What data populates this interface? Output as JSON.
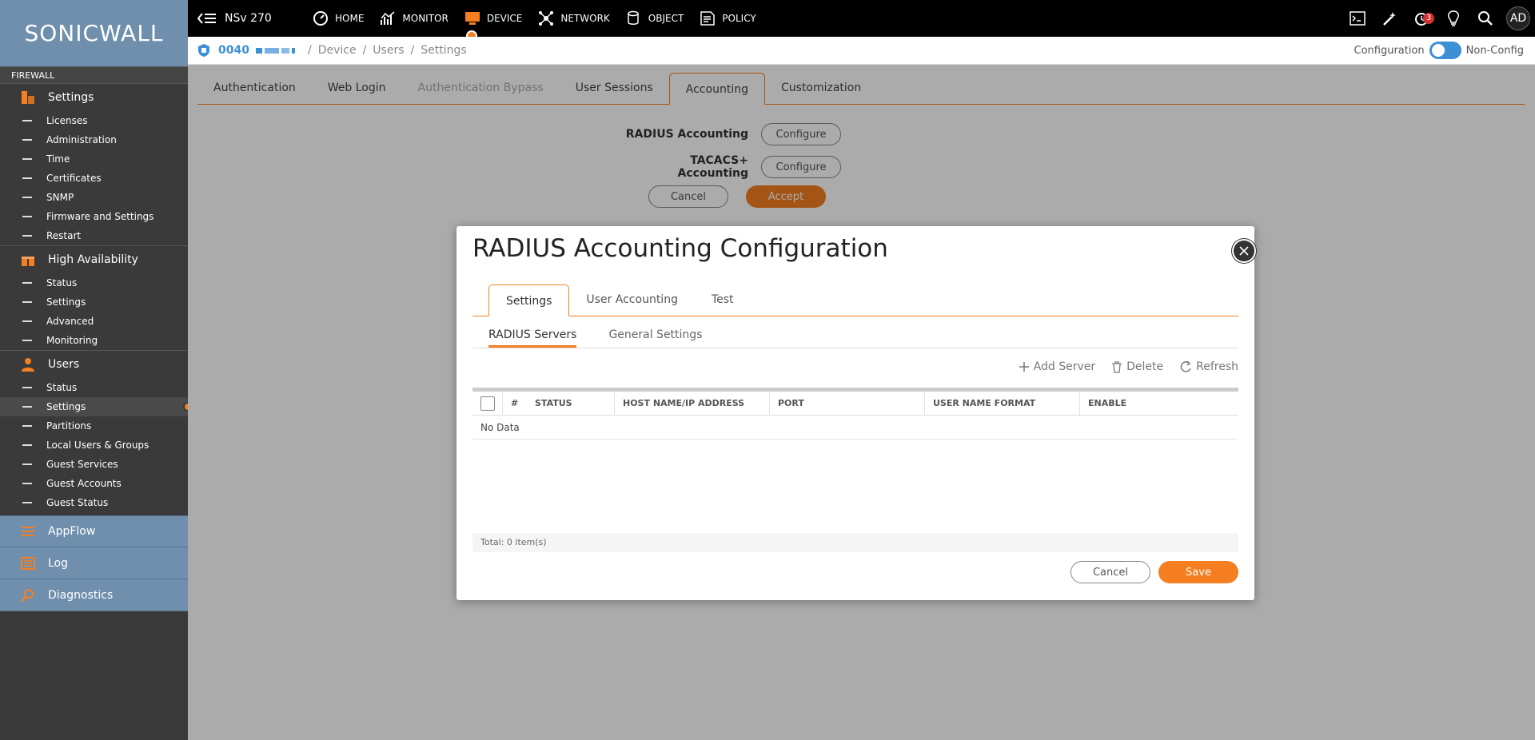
{
  "app": {
    "logo_text": "SONICWALL",
    "device_name": "NSv 270"
  },
  "sidebar": {
    "section_label": "FIREWALL",
    "groups": [
      {
        "label": "Settings",
        "items": [
          "Licenses",
          "Administration",
          "Time",
          "Certificates",
          "SNMP",
          "Firmware and Settings",
          "Restart"
        ]
      },
      {
        "label": "High Availability",
        "items": [
          "Status",
          "Settings",
          "Advanced",
          "Monitoring"
        ]
      },
      {
        "label": "Users",
        "items": [
          "Status",
          "Settings",
          "Partitions",
          "Local Users & Groups",
          "Guest Services",
          "Guest Accounts",
          "Guest Status"
        ]
      }
    ],
    "active_item": "Users / Settings",
    "bottom_items": [
      "AppFlow",
      "Log",
      "Diagnostics"
    ]
  },
  "topnav": {
    "items": [
      "HOME",
      "MONITOR",
      "DEVICE",
      "NETWORK",
      "OBJECT",
      "POLICY"
    ],
    "active": "DEVICE",
    "notification_count": "3",
    "avatar_initials": "AD"
  },
  "breadcrumb": {
    "serial": "0040",
    "items": [
      "Device",
      "Users",
      "Settings"
    ],
    "mode_left": "Configuration",
    "mode_right": "Non-Config"
  },
  "page": {
    "tabs": [
      "Authentication",
      "Web Login",
      "Authentication Bypass",
      "User Sessions",
      "Accounting",
      "Customization"
    ],
    "active_tab": "Accounting",
    "disabled_tab": "Authentication Bypass",
    "radius_label": "RADIUS Accounting",
    "tacacs_label": "TACACS+ Accounting",
    "configure_label": "Configure",
    "cancel_label": "Cancel",
    "accept_label": "Accept"
  },
  "modal": {
    "title": "RADIUS Accounting Configuration",
    "tabs": [
      "Settings",
      "User Accounting",
      "Test"
    ],
    "active_tab": "Settings",
    "sub_tabs": [
      "RADIUS Servers",
      "General Settings"
    ],
    "active_sub_tab": "RADIUS Servers",
    "toolbar": {
      "add": "Add Server",
      "delete": "Delete",
      "refresh": "Refresh"
    },
    "columns": [
      "#",
      "STATUS",
      "HOST NAME/IP ADDRESS",
      "PORT",
      "USER NAME FORMAT",
      "ENABLE"
    ],
    "no_data": "No Data",
    "total": "Total:  0 item(s)",
    "cancel_label": "Cancel",
    "save_label": "Save"
  },
  "colors": {
    "accent": "#f57f20",
    "link_blue": "#3d8fd6",
    "sidebar_bg": "#3a3a3a",
    "sidebar_blue": "#6f8fad",
    "topbar_bg": "#000000"
  }
}
